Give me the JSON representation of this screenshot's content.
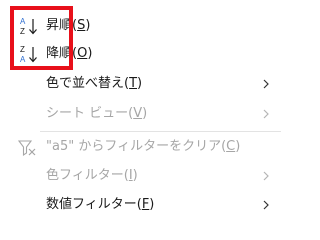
{
  "menu": {
    "sort_asc": {
      "label": "昇順(",
      "accel": "S",
      "close": ")",
      "icon": "sort-ascending-icon",
      "icon_top": "A",
      "icon_bottom": "Z"
    },
    "sort_desc": {
      "label": "降順(",
      "accel": "O",
      "close": ")",
      "icon": "sort-descending-icon",
      "icon_top": "Z",
      "icon_bottom": "A"
    },
    "sort_by_color": {
      "label": "色で並べ替え(",
      "accel": "T",
      "close": ")",
      "has_submenu": true,
      "enabled": true
    },
    "sheet_view": {
      "label": "シート ビュー(",
      "accel": "V",
      "close": ")",
      "has_submenu": true,
      "enabled": false
    },
    "clear_filter": {
      "label": "\"a5\" からフィルターをクリア(",
      "accel": "C",
      "close": ")",
      "icon": "filter-clear-icon",
      "enabled": false
    },
    "color_filter": {
      "label": "色フィルター(",
      "accel": "I",
      "close": ")",
      "has_submenu": true,
      "enabled": false
    },
    "number_filter": {
      "label": "数値フィルター(",
      "accel": "F",
      "close": ")",
      "has_submenu": true,
      "enabled": true
    }
  },
  "colors": {
    "text": "#1a1a1a",
    "disabled_text": "#a6a6a6",
    "icon_blue": "#2f6fd1",
    "highlight": "#e8101a",
    "divider": "#e3e3e3"
  }
}
